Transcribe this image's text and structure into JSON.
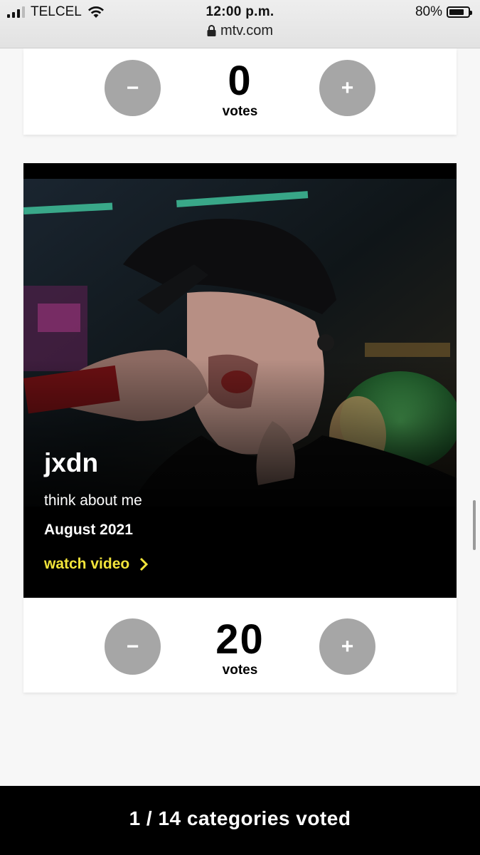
{
  "status_bar": {
    "carrier": "TELCEL",
    "time": "12:00 p.m.",
    "battery": "80%",
    "battery_level": 0.8,
    "url": "mtv.com"
  },
  "top_card": {
    "minus_label": "−",
    "plus_label": "+",
    "votes": "0",
    "votes_label": "votes"
  },
  "nominee": {
    "artist": "jxdn",
    "song": "think about me",
    "date": "August 2021",
    "watch_label": "watch video",
    "minus_label": "−",
    "plus_label": "+",
    "votes": "20",
    "votes_label": "votes"
  },
  "footer": {
    "progress": "1 / 14 categories voted"
  },
  "colors": {
    "accent": "#f2e43a",
    "vote_button": "#a6a6a6"
  }
}
